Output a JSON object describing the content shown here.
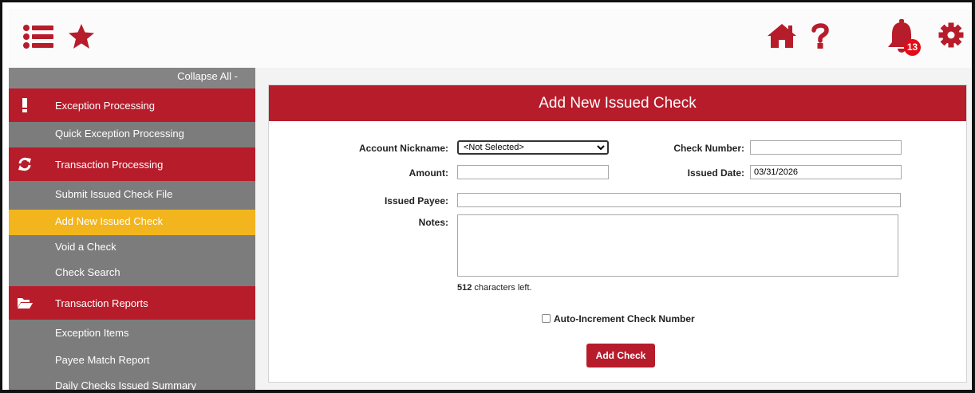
{
  "topbar": {
    "notification_count": "13",
    "icons": [
      "menu-list-icon",
      "star-icon",
      "home-icon",
      "help-icon",
      "bell-icon",
      "gear-icon"
    ]
  },
  "sidebar": {
    "collapse_label": "Collapse All -",
    "sections": [
      {
        "label": "Exception Processing",
        "icon": "exclamation-icon"
      },
      {
        "label": "Transaction Processing",
        "icon": "refresh-icon"
      },
      {
        "label": "Transaction Reports",
        "icon": "folder-open-icon"
      }
    ],
    "items": {
      "quick_exception": "Quick Exception Processing",
      "submit_file": "Submit Issued Check File",
      "add_new": "Add New Issued Check",
      "void_check": "Void a Check",
      "check_search": "Check Search",
      "exception_items": "Exception Items",
      "payee_match": "Payee Match Report",
      "daily_summary": "Daily Checks Issued Summary"
    }
  },
  "form": {
    "title": "Add New Issued Check",
    "account_nickname_label": "Account Nickname:",
    "account_nickname_value": "<Not Selected>",
    "check_number_label": "Check Number:",
    "check_number_value": "",
    "amount_label": "Amount:",
    "amount_value": "",
    "issued_date_label": "Issued Date:",
    "issued_date_value": "03/31/2026",
    "issued_payee_label": "Issued Payee:",
    "issued_payee_value": "",
    "notes_label": "Notes:",
    "notes_value": "",
    "chars_left_count": "512",
    "chars_left_text": " characters left.",
    "auto_increment_label": "Auto-Increment Check Number",
    "auto_increment_checked": false,
    "submit_label": "Add Check"
  },
  "colors": {
    "brand_red": "#b71c2b",
    "active_item": "#f2b51e",
    "sidebar_gray": "#7c7c7c",
    "badge_red": "#e30b17"
  }
}
